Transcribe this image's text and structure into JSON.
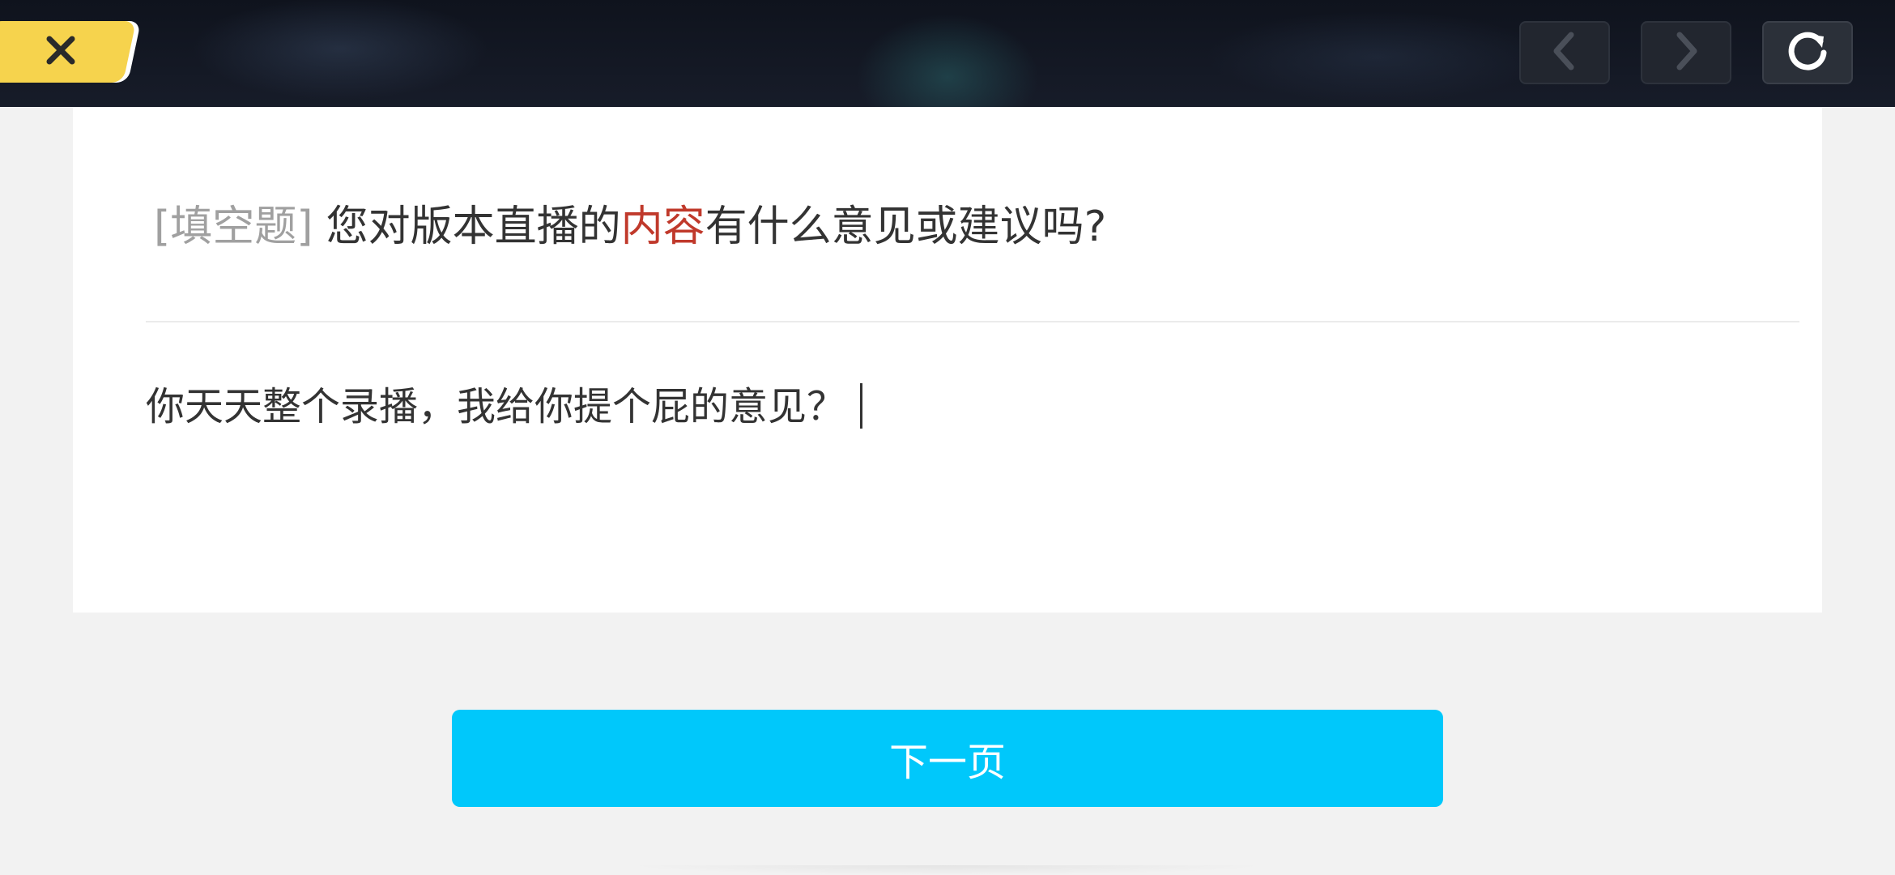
{
  "header": {
    "close_icon": "close-x-icon",
    "prev_icon": "chevron-left-icon",
    "next_icon": "chevron-right-icon",
    "refresh_icon": "refresh-icon"
  },
  "question": {
    "tag": "[填空题]",
    "text_before": "您对版本直播的",
    "text_highlight": "内容",
    "text_after": "有什么意见或建议吗?"
  },
  "answer": {
    "value": "你天天整个录播，我给你提个屁的意见？"
  },
  "footer": {
    "next_page_label": "下一页"
  },
  "colors": {
    "close_button": "#f6d34d",
    "highlight": "#c0392b",
    "next_button": "#00c8fb",
    "tag": "#a0a0a0"
  }
}
